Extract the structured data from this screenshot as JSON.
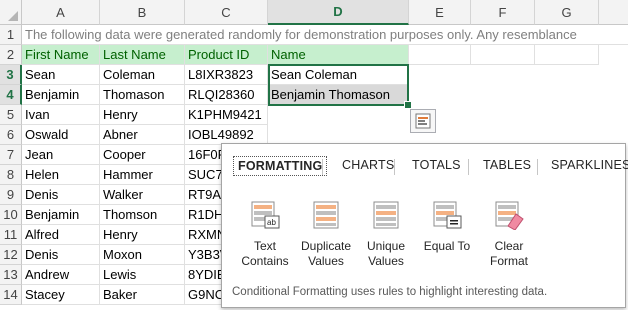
{
  "columns": [
    "A",
    "B",
    "C",
    "D",
    "E",
    "F",
    "G"
  ],
  "selected_column": "D",
  "rows": [
    {
      "num": "1",
      "cells": [
        "The following data were generated randomly for demonstration purposes only. Any resemblance",
        "",
        "",
        "",
        "",
        "",
        ""
      ]
    },
    {
      "num": "2",
      "cells": [
        "First Name",
        "Last Name",
        "Product ID",
        "Name",
        "",
        "",
        ""
      ]
    },
    {
      "num": "3",
      "cells": [
        "Sean",
        "Coleman",
        "L8IXR3823",
        "Sean Coleman",
        "",
        "",
        ""
      ]
    },
    {
      "num": "4",
      "cells": [
        "Benjamin",
        "Thomason",
        "RLQI28360",
        "Benjamin Thomason",
        "",
        "",
        ""
      ]
    },
    {
      "num": "5",
      "cells": [
        "Ivan",
        "Henry",
        "K1PHM9421",
        "",
        "",
        "",
        ""
      ]
    },
    {
      "num": "6",
      "cells": [
        "Oswald",
        "Abner",
        "IOBL49892",
        "",
        "",
        "",
        ""
      ]
    },
    {
      "num": "7",
      "cells": [
        "Jean",
        "Cooper",
        "16F0F",
        "",
        "",
        "",
        ""
      ]
    },
    {
      "num": "8",
      "cells": [
        "Helen",
        "Hammer",
        "SUC7",
        "",
        "",
        "",
        ""
      ]
    },
    {
      "num": "9",
      "cells": [
        "Denis",
        "Walker",
        "RT9A",
        "",
        "",
        "",
        ""
      ]
    },
    {
      "num": "10",
      "cells": [
        "Benjamin",
        "Thomson",
        "R1DH",
        "",
        "",
        "",
        ""
      ]
    },
    {
      "num": "11",
      "cells": [
        "Alfred",
        "Henry",
        "RXMN",
        "",
        "",
        "",
        ""
      ]
    },
    {
      "num": "12",
      "cells": [
        "Denis",
        "Moxon",
        "Y3B3V",
        "",
        "",
        "",
        ""
      ]
    },
    {
      "num": "13",
      "cells": [
        "Andrew",
        "Lewis",
        "8YDIE",
        "",
        "",
        "",
        ""
      ]
    },
    {
      "num": "14",
      "cells": [
        "Stacey",
        "Baker",
        "G9NC",
        "",
        "",
        "",
        ""
      ]
    }
  ],
  "selected_rows": [
    "3",
    "4"
  ],
  "quick_analysis": {
    "tabs": [
      "FORMATTING",
      "CHARTS",
      "TOTALS",
      "TABLES",
      "SPARKLINES"
    ],
    "active_tab": "FORMATTING",
    "options": [
      {
        "label1": "Text",
        "label2": "Contains",
        "icon": "text-contains-icon"
      },
      {
        "label1": "Duplicate",
        "label2": "Values",
        "icon": "duplicate-values-icon"
      },
      {
        "label1": "Unique",
        "label2": "Values",
        "icon": "unique-values-icon"
      },
      {
        "label1": "Equal To",
        "label2": "",
        "icon": "equal-to-icon"
      },
      {
        "label1": "Clear",
        "label2": "Format",
        "icon": "clear-format-icon"
      }
    ],
    "description": "Conditional Formatting uses rules to highlight interesting data."
  },
  "colors": {
    "header_green": "#c6efce",
    "header_text": "#006100",
    "accent": "#217346",
    "note_text": "#7f7f7f"
  }
}
